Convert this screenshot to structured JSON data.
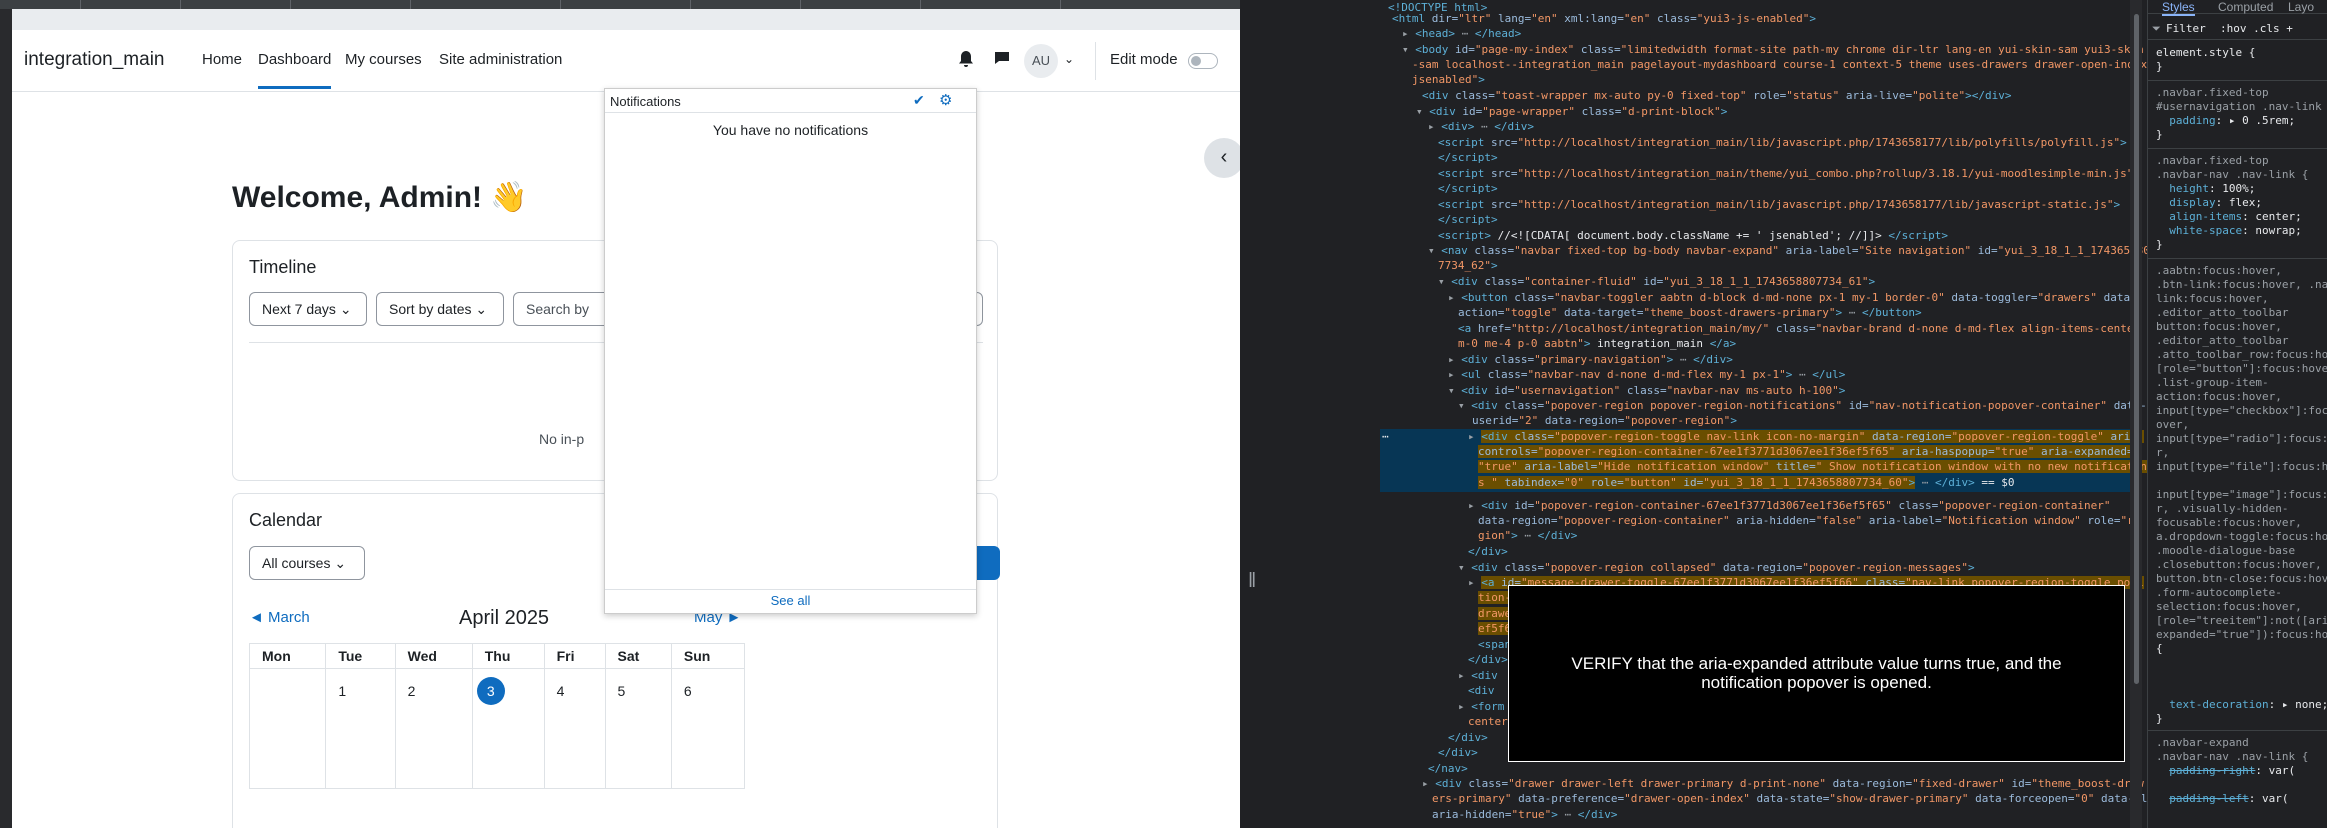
{
  "browser": {
    "site_name": "integration_main",
    "nav": {
      "home": "Home",
      "dashboard": "Dashboard",
      "my_courses": "My courses",
      "site_admin": "Site administration"
    },
    "user_initials": "AU",
    "edit_mode_label": "Edit mode",
    "welcome": "Welcome, Admin! 👋",
    "timeline": {
      "title": "Timeline",
      "filter_days": "Next 7 days",
      "sort": "Sort by dates",
      "search_placeholder": "Search by",
      "empty_text": "No in-p"
    },
    "calendar": {
      "title": "Calendar",
      "course_filter": "All courses",
      "prev": "◄ March",
      "next": "May ►",
      "month": "April 2025",
      "days": [
        "Mon",
        "Tue",
        "Wed",
        "Thu",
        "Fri",
        "Sat",
        "Sun"
      ],
      "week1": [
        "",
        "1",
        "2",
        "3",
        "4",
        "5",
        "6"
      ],
      "today": "3"
    },
    "notifications": {
      "title": "Notifications",
      "empty": "You have no notifications",
      "see_all": "See all"
    }
  },
  "devtools": {
    "tabs": {
      "styles": "Styles",
      "computed": "Computed",
      "layout": "Layo"
    },
    "filter_label": "Filter",
    "filter_tools": ":hov .cls +",
    "selected_marker": "== $0",
    "overlay_text": "VERIFY that the aria-expanded attribute value turns true, and the notification popover is opened."
  },
  "colors": {
    "brand_blue": "#0f6cbf",
    "devtools_bg": "#202124",
    "selection": "#073655"
  }
}
